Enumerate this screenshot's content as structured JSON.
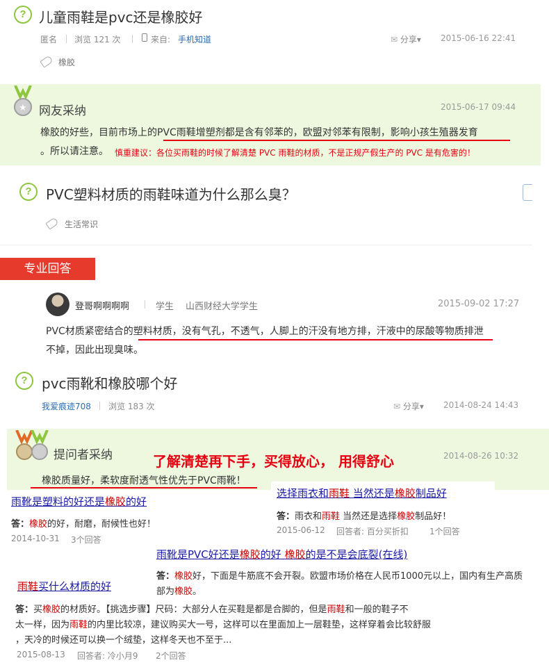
{
  "q1": {
    "title": "儿童雨鞋是pvc还是橡胶好",
    "anon": "匿名",
    "views": "浏览 121 次",
    "source_label": "来自:",
    "source_link": "手机知道",
    "share": "分享",
    "date": "2015-06-16 22:41",
    "tag": "橡胶"
  },
  "a1": {
    "title": "网友采纳",
    "date": "2015-06-17 09:44",
    "line1_pre": "橡胶的好些，目前市场上的",
    "line1_ul": "PVC雨鞋增塑剂都是含有邻苯的，欧盟对邻苯有限制，影响小孩生殖器发育",
    "line2": "。所以请注意。",
    "red_note": "慎重建议：各位买雨鞋的时候了解清楚 PVC 雨鞋的材质，不是正规产假生产的 PVC 是有危害的！"
  },
  "q2": {
    "title": "PVC塑料材质的雨鞋味道为什么那么臭？",
    "tag": "生活常识"
  },
  "pro": {
    "tab": "专业回答",
    "name": "登哥啊啊啊啊",
    "role": "学生",
    "org": "山西财经大学学生",
    "date": "2015-09-02 17:27",
    "line1_pre": "PVC材质紧密结合的",
    "line1_ul": "塑料材质，没有气孔，不透气，人脚上的汗没有地方排，汗液中的尿酸等物质排泄",
    "line2": "不掉，因此出现臭味。"
  },
  "q3": {
    "title": "pvc雨靴和橡胶哪个好",
    "user": "我爱痕迹708",
    "views": "浏览 183 次",
    "share": "分享",
    "date": "2014-08-24 14:43"
  },
  "a3": {
    "title": "提问者采纳",
    "big_note": "了解清楚再下手，买得放心，  用得舒心",
    "date": "2014-08-26 10:32",
    "text": "橡胶质量好，柔软度耐透气性优先于PVC雨靴！"
  },
  "r1": {
    "link_a": "雨靴是塑料的好还是",
    "link_hl": "橡胶",
    "link_b": "的好",
    "ans_label": "答：",
    "ans_hl": "橡胶",
    "ans_rest": "的好，耐磨，耐候性也好！",
    "date": "2014-10-31",
    "count": "3个回答"
  },
  "r2": {
    "link_a": "选择雨衣和",
    "link_hl1": "雨鞋",
    "link_b": " 当然还是",
    "link_hl2": "橡胶",
    "link_c": "制品好",
    "ans_label": "答：",
    "ans_a": "雨衣和",
    "ans_hl1": "雨鞋",
    "ans_b": " 当然还是选择",
    "ans_hl2": "橡胶",
    "ans_c": "制品好！",
    "date": "2015-06-12",
    "answerer": "回答者: 百分买折扣",
    "count": "1个回答"
  },
  "r3": {
    "link_a": "雨靴是PVC好还是",
    "link_hl1": "橡胶",
    "link_b": "的好 ",
    "link_hl2": "橡胶",
    "link_c": "的是不是会底裂(在线)",
    "ans_label": "答：",
    "ans_hl1": "橡胶",
    "ans_a": "好，下面是牛筋底不会开裂。欧盟市场价格在人民币1000元以上，国内有生产高质",
    "ans_b": "部为",
    "ans_hl2": "橡胶",
    "ans_c": "。"
  },
  "r4": {
    "link_hl": "雨鞋",
    "link_rest": "买什么材质的好",
    "ans_label": "答：",
    "ans_a": "买",
    "ans_hl1": "橡胶",
    "ans_b": "的材质好。【挑选步骤】尺码：大部分人在买鞋是都是合脚的，但是",
    "ans_hl2": "雨鞋",
    "ans_c": "和一般的鞋子不",
    "line2_a": "太一样，因为",
    "line2_hl": "雨鞋",
    "line2_b": "的内里比较凉，建议购买大一号，这样可以在里面加上一层鞋垫，这样穿着会比较舒服",
    "line3": "，天冷的时候还可以换一个绒垫，这样冬天也不至于...",
    "date": "2015-08-13",
    "answerer": "回答者: 冷小月9",
    "count": "2个回答"
  },
  "colors": {
    "accent_green": "#8dc63f",
    "adopt_bg": "#eef8df",
    "red": "#e60012",
    "pro_tab": "#e53a2c",
    "link_blue": "#2b6bb3"
  }
}
